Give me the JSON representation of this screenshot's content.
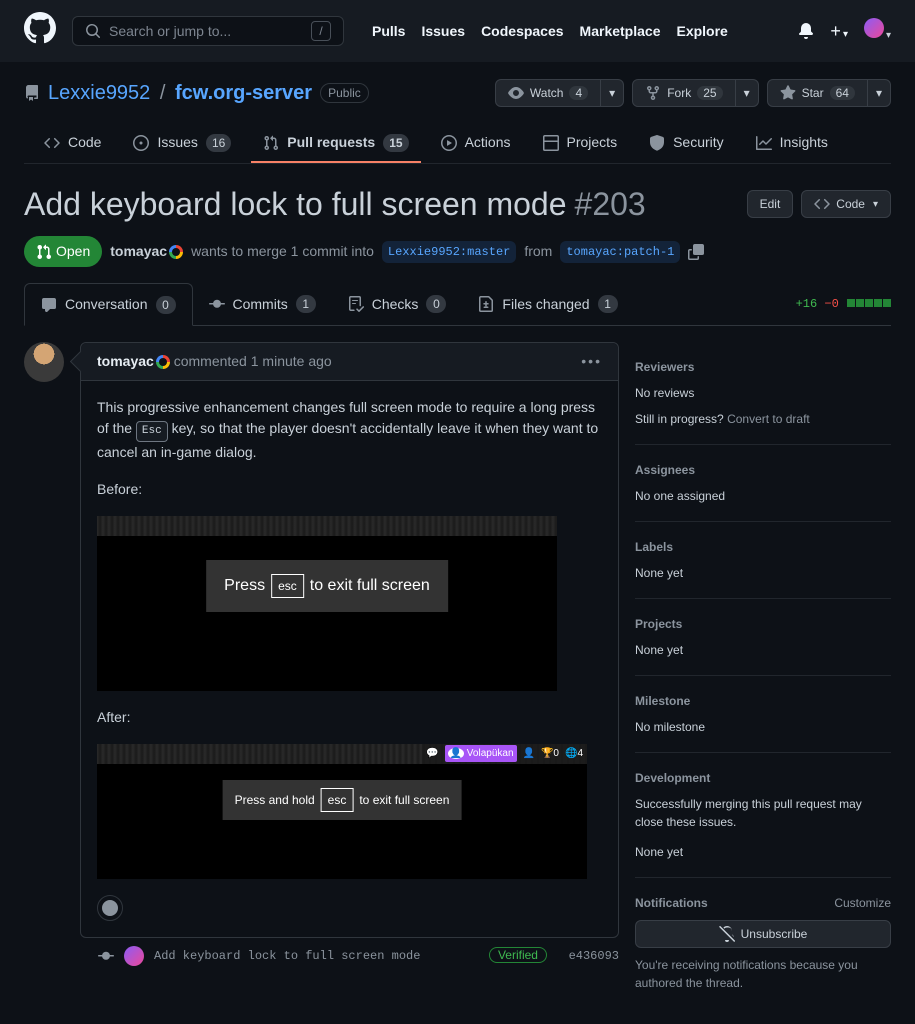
{
  "search_placeholder": "Search or jump to...",
  "top_nav": {
    "pulls": "Pulls",
    "issues": "Issues",
    "codespaces": "Codespaces",
    "marketplace": "Marketplace",
    "explore": "Explore"
  },
  "repo": {
    "owner": "Lexxie9952",
    "name": "fcw.org-server",
    "visibility": "Public"
  },
  "repo_actions": {
    "watch": "Watch",
    "watch_count": "4",
    "fork": "Fork",
    "fork_count": "25",
    "star": "Star",
    "star_count": "64"
  },
  "repo_tabs": {
    "code": "Code",
    "issues": "Issues",
    "issues_count": "16",
    "pulls": "Pull requests",
    "pulls_count": "15",
    "actions": "Actions",
    "projects": "Projects",
    "security": "Security",
    "insights": "Insights"
  },
  "pr": {
    "title": "Add keyboard lock to full screen mode",
    "number": "#203",
    "state": "Open",
    "author": "tomayac",
    "meta_text1": "wants to merge 1 commit into",
    "base": "Lexxie9952:master",
    "meta_text2": "from",
    "head": "tomayac:patch-1",
    "edit": "Edit",
    "code_btn": "Code"
  },
  "pr_tabs": {
    "conv": "Conversation",
    "conv_count": "0",
    "commits": "Commits",
    "commits_count": "1",
    "checks": "Checks",
    "checks_count": "0",
    "files": "Files changed",
    "files_count": "1"
  },
  "diff": {
    "add": "+16",
    "del": "−0"
  },
  "comment": {
    "author": "tomayac",
    "time_prefix": "commented",
    "time": "1 minute ago",
    "body1a": "This progressive enhancement changes full screen mode to require a long press of the ",
    "esc": "Esc",
    "body1b": " key, so that the player doesn't accidentally leave it when they want to cancel an in-game dialog.",
    "before_label": "Before:",
    "after_label": "After:",
    "toast_before_a": "Press",
    "toast_before_esc": "esc",
    "toast_before_b": "to exit full screen",
    "toast_after_a": "Press and hold",
    "toast_after_esc": "esc",
    "toast_after_b": "to exit full screen",
    "after_bar_nation": "Volapükan",
    "after_bar_coin": "0",
    "after_bar_flag": "4"
  },
  "commit": {
    "msg": "Add keyboard lock to full screen mode",
    "verified": "Verified",
    "sha": "e436093"
  },
  "sidebar": {
    "reviewers_h": "Reviewers",
    "reviewers_v": "No reviews",
    "draft_q": "Still in progress?",
    "draft_link": "Convert to draft",
    "assignees_h": "Assignees",
    "assignees_v": "No one assigned",
    "labels_h": "Labels",
    "labels_v": "None yet",
    "projects_h": "Projects",
    "projects_v": "None yet",
    "milestone_h": "Milestone",
    "milestone_v": "No milestone",
    "dev_h": "Development",
    "dev_v": "Successfully merging this pull request may close these issues.",
    "dev_none": "None yet",
    "notif_h": "Notifications",
    "customize": "Customize",
    "unsub": "Unsubscribe",
    "notif_desc": "You're receiving notifications because you authored the thread."
  }
}
